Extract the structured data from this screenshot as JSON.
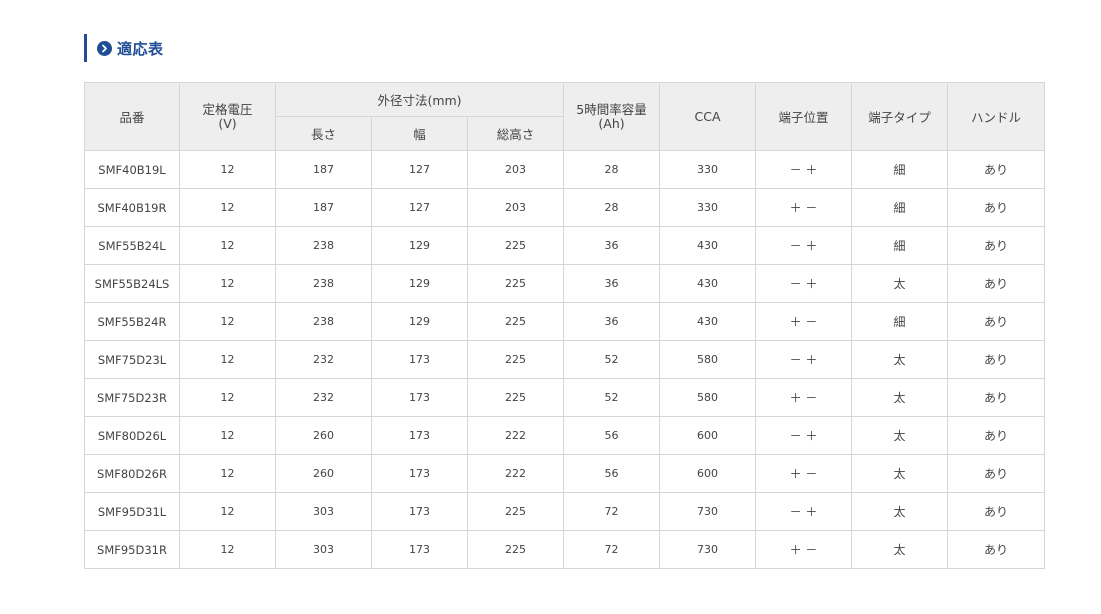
{
  "section": {
    "title": "適応表"
  },
  "table": {
    "headers": {
      "model": "品番",
      "rated_voltage_line1": "定格電圧",
      "rated_voltage_line2": "(V)",
      "outer_dims": "外径寸法(mm)",
      "length": "長さ",
      "width": "幅",
      "total_height": "総高さ",
      "capacity_line1": "5時間率容量",
      "capacity_line2": "(Ah)",
      "cca": "CCA",
      "terminal_position": "端子位置",
      "terminal_type": "端子タイプ",
      "handle": "ハンドル"
    },
    "rows": [
      {
        "model": "SMF40B19L",
        "voltage": "12",
        "length": "187",
        "width": "127",
        "height": "203",
        "capacity": "28",
        "cca": "330",
        "terminal_position": "－ ＋",
        "terminal_type": "細",
        "handle": "あり"
      },
      {
        "model": "SMF40B19R",
        "voltage": "12",
        "length": "187",
        "width": "127",
        "height": "203",
        "capacity": "28",
        "cca": "330",
        "terminal_position": "＋ －",
        "terminal_type": "細",
        "handle": "あり"
      },
      {
        "model": "SMF55B24L",
        "voltage": "12",
        "length": "238",
        "width": "129",
        "height": "225",
        "capacity": "36",
        "cca": "430",
        "terminal_position": "－ ＋",
        "terminal_type": "細",
        "handle": "あり"
      },
      {
        "model": "SMF55B24LS",
        "voltage": "12",
        "length": "238",
        "width": "129",
        "height": "225",
        "capacity": "36",
        "cca": "430",
        "terminal_position": "－ ＋",
        "terminal_type": "太",
        "handle": "あり"
      },
      {
        "model": "SMF55B24R",
        "voltage": "12",
        "length": "238",
        "width": "129",
        "height": "225",
        "capacity": "36",
        "cca": "430",
        "terminal_position": "＋ －",
        "terminal_type": "細",
        "handle": "あり"
      },
      {
        "model": "SMF75D23L",
        "voltage": "12",
        "length": "232",
        "width": "173",
        "height": "225",
        "capacity": "52",
        "cca": "580",
        "terminal_position": "－ ＋",
        "terminal_type": "太",
        "handle": "あり"
      },
      {
        "model": "SMF75D23R",
        "voltage": "12",
        "length": "232",
        "width": "173",
        "height": "225",
        "capacity": "52",
        "cca": "580",
        "terminal_position": "＋ －",
        "terminal_type": "太",
        "handle": "あり"
      },
      {
        "model": "SMF80D26L",
        "voltage": "12",
        "length": "260",
        "width": "173",
        "height": "222",
        "capacity": "56",
        "cca": "600",
        "terminal_position": "－ ＋",
        "terminal_type": "太",
        "handle": "あり"
      },
      {
        "model": "SMF80D26R",
        "voltage": "12",
        "length": "260",
        "width": "173",
        "height": "222",
        "capacity": "56",
        "cca": "600",
        "terminal_position": "＋ －",
        "terminal_type": "太",
        "handle": "あり"
      },
      {
        "model": "SMF95D31L",
        "voltage": "12",
        "length": "303",
        "width": "173",
        "height": "225",
        "capacity": "72",
        "cca": "730",
        "terminal_position": "－ ＋",
        "terminal_type": "太",
        "handle": "あり"
      },
      {
        "model": "SMF95D31R",
        "voltage": "12",
        "length": "303",
        "width": "173",
        "height": "225",
        "capacity": "72",
        "cca": "730",
        "terminal_position": "＋ －",
        "terminal_type": "太",
        "handle": "あり"
      }
    ]
  },
  "colors": {
    "accent": "#1f4e96",
    "header_bg": "#eeeeee",
    "border": "#d6d6d6"
  },
  "icons": {
    "heading_icon": "chevron-right-circle-icon"
  }
}
